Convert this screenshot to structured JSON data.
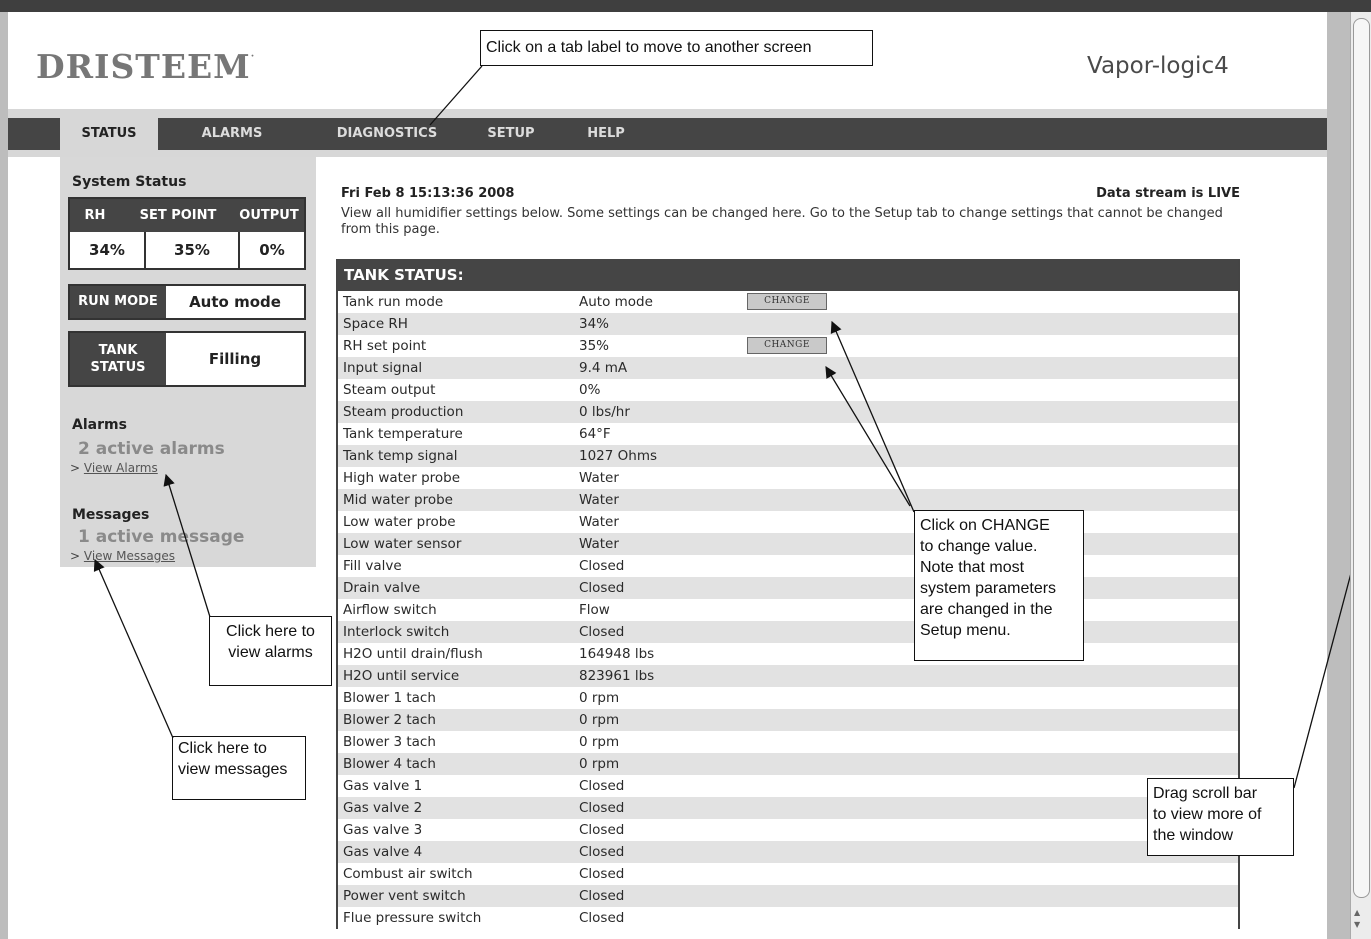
{
  "header": {
    "logo_text": "DRISTEEM",
    "logo_mark": "·",
    "product": "Vapor-logic4"
  },
  "nav": {
    "tabs": [
      "STATUS",
      "ALARMS",
      "DIAGNOSTICS",
      "SETUP",
      "HELP"
    ],
    "active": "STATUS"
  },
  "sidebar": {
    "system_status_title": "System Status",
    "columns": [
      "RH",
      "SET POINT",
      "OUTPUT"
    ],
    "values": [
      "34%",
      "35%",
      "0%"
    ],
    "run_mode_label": "RUN MODE",
    "run_mode_value": "Auto mode",
    "tank_status_label_1": "TANK",
    "tank_status_label_2": "STATUS",
    "tank_status_value": "Filling",
    "alarms_title": "Alarms",
    "alarms_count": "2 active alarms",
    "alarms_link_prefix": ">",
    "alarms_link": "View Alarms",
    "messages_title": "Messages",
    "messages_count": "1 active message",
    "messages_link_prefix": ">",
    "messages_link": "View Messages"
  },
  "main": {
    "datetime": "Fri Feb 8 15:13:36 2008",
    "stream_status": "Data stream is LIVE",
    "intro": "View all humidifier settings below. Some settings can be changed here. Go to the Setup tab to change settings that cannot be changed from this page.",
    "tank_status_title": "TANK STATUS:",
    "change_label": "CHANGE",
    "rows": [
      {
        "label": "Tank run mode",
        "value": "Auto mode",
        "change": true
      },
      {
        "label": "Space RH",
        "value": "34%"
      },
      {
        "label": "RH set point",
        "value": "35%",
        "change": true
      },
      {
        "label": "Input signal",
        "value": "9.4 mA"
      },
      {
        "label": "Steam output",
        "value": "0%"
      },
      {
        "label": "Steam production",
        "value": "0 lbs/hr"
      },
      {
        "label": "Tank temperature",
        "value": "64°F"
      },
      {
        "label": "Tank temp signal",
        "value": "1027 Ohms"
      },
      {
        "label": "High water probe",
        "value": "Water"
      },
      {
        "label": "Mid water probe",
        "value": "Water"
      },
      {
        "label": "Low water probe",
        "value": "Water"
      },
      {
        "label": "Low water sensor",
        "value": "Water"
      },
      {
        "label": "Fill valve",
        "value": "Closed"
      },
      {
        "label": "Drain valve",
        "value": "Closed"
      },
      {
        "label": "Airflow switch",
        "value": "Flow"
      },
      {
        "label": "Interlock switch",
        "value": "Closed"
      },
      {
        "label": "H2O until drain/flush",
        "value": "164948 lbs"
      },
      {
        "label": "H2O until service",
        "value": "823961 lbs"
      },
      {
        "label": "Blower 1 tach",
        "value": "0 rpm"
      },
      {
        "label": "Blower 2 tach",
        "value": "0 rpm"
      },
      {
        "label": "Blower 3 tach",
        "value": "0 rpm"
      },
      {
        "label": "Blower 4 tach",
        "value": "0 rpm"
      },
      {
        "label": "Gas valve 1",
        "value": "Closed"
      },
      {
        "label": "Gas valve 2",
        "value": "Closed"
      },
      {
        "label": "Gas valve 3",
        "value": "Closed"
      },
      {
        "label": "Gas valve 4",
        "value": "Closed"
      },
      {
        "label": "Combust air switch",
        "value": "Closed"
      },
      {
        "label": "Power vent switch",
        "value": "Closed"
      },
      {
        "label": "Flue pressure switch",
        "value": "Closed"
      }
    ]
  },
  "callouts": {
    "tabs": "Click on a tab label to move to another screen",
    "alarms_1": "Click here to",
    "alarms_2": "view alarms",
    "messages_1": "Click here to",
    "messages_2": "view messages",
    "change_1": "Click on CHANGE",
    "change_2": "to change value.",
    "change_3": "Note that most",
    "change_4": "system parameters",
    "change_5": "are changed in the",
    "change_6": "Setup menu.",
    "scroll_1": "Drag scroll bar",
    "scroll_2": "to view more of",
    "scroll_3": "the window"
  },
  "scrollbar": {
    "up_arrow": "▲",
    "down_arrow": "▼"
  }
}
